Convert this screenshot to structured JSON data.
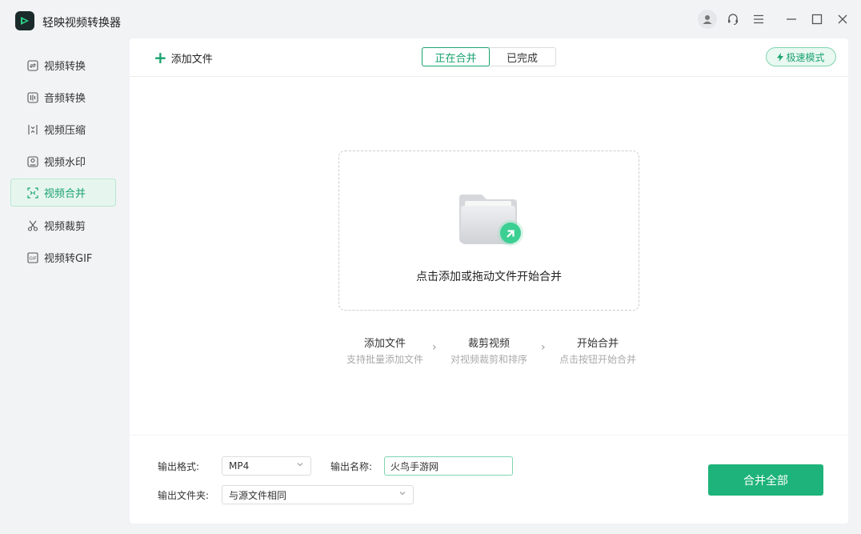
{
  "app": {
    "title": "轻映视频转换器"
  },
  "sidebar": {
    "items": [
      {
        "label": "视频转换",
        "icon": "convert-icon"
      },
      {
        "label": "音频转换",
        "icon": "audio-icon"
      },
      {
        "label": "视频压缩",
        "icon": "compress-icon"
      },
      {
        "label": "视频水印",
        "icon": "watermark-icon"
      },
      {
        "label": "视频合并",
        "icon": "merge-icon",
        "active": true
      },
      {
        "label": "视频裁剪",
        "icon": "scissors-icon"
      },
      {
        "label": "视频转GIF",
        "icon": "gif-icon"
      }
    ]
  },
  "toolbar": {
    "add_label": "添加文件",
    "tabs": [
      {
        "label": "正在合并",
        "active": true
      },
      {
        "label": "已完成"
      }
    ],
    "fast_mode_label": "极速模式"
  },
  "dropzone": {
    "text": "点击添加或拖动文件开始合并"
  },
  "steps": [
    {
      "title": "添加文件",
      "sub": "支持批量添加文件"
    },
    {
      "title": "裁剪视频",
      "sub": "对视频裁剪和排序"
    },
    {
      "title": "开始合并",
      "sub": "点击按钮开始合并"
    }
  ],
  "output": {
    "format_label": "输出格式:",
    "format_value": "MP4",
    "name_label": "输出名称:",
    "name_value": "火鸟手游网",
    "folder_label": "输出文件夹:",
    "folder_value": "与源文件相同",
    "merge_all_label": "合并全部"
  },
  "colors": {
    "accent": "#1eb37a",
    "accent_text": "#1aa36f",
    "accent_light": "#e6f6ef"
  }
}
